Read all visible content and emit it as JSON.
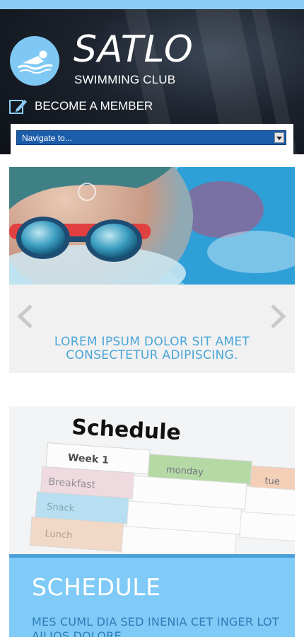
{
  "header": {
    "brand": "SATLO",
    "tagline": "SWIMMING CLUB",
    "member_link": "BECOME A MEMBER",
    "nav_select": "Navigate to..."
  },
  "slider": {
    "caption": "LOREM IPSUM DOLOR SIT AMET CONSECTETUR ADIPISCING."
  },
  "schedule_image": {
    "heading": "Schedule",
    "cells": [
      "Week 1",
      "monday",
      "tue",
      "Breakfast",
      "Snack",
      "Lunch"
    ]
  },
  "card": {
    "title": "SCHEDULE",
    "text": "MES CUML DIA SED INENIA CET INGER LOT AILIOS DOLORE"
  },
  "colors": {
    "accent": "#7fcaf6",
    "nav_blue": "#1c5daa",
    "caption_blue": "#4aa6d8"
  },
  "icons": [
    "swimmer-icon",
    "pencil-icon",
    "dropdown-arrow-icon",
    "chevron-left-icon",
    "chevron-right-icon"
  ]
}
